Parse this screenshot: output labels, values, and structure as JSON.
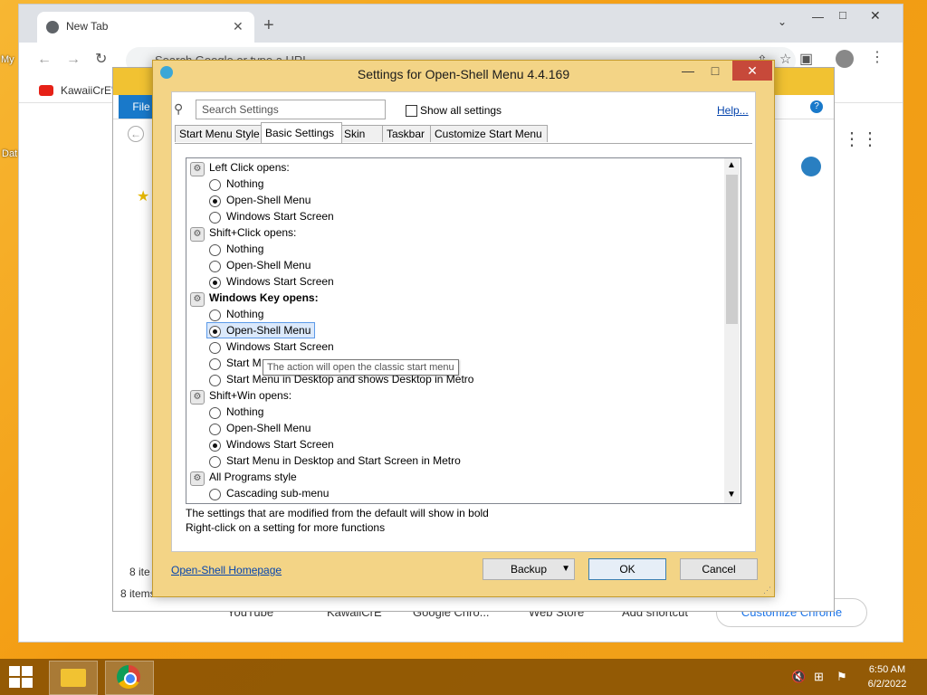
{
  "desktop": {
    "labels": [
      "My",
      "Dat"
    ]
  },
  "chrome": {
    "tab_title": "New Tab",
    "omnibox_placeholder": "Search Google or type a URL",
    "bookmark_1": "KawaiiCrE's",
    "shortcuts": [
      "YouTube",
      "KawaiiCrE",
      "Google Chro...",
      "Web Store",
      "Add shortcut"
    ],
    "customize_label": "Customize Chrome"
  },
  "explorer": {
    "file_tab": "File",
    "status_a": "8 ite",
    "status_b": "8 items"
  },
  "dialog": {
    "title": "Settings for Open-Shell Menu 4.4.169",
    "search_placeholder": "Search Settings",
    "show_all_label": "Show all settings",
    "help_link": "Help...",
    "tabs": [
      "Start Menu Style",
      "Basic Settings",
      "Skin",
      "Taskbar",
      "Customize Start Menu"
    ],
    "settings": {
      "left_click": {
        "heading": "Left Click opens:",
        "options": [
          "Nothing",
          "Open-Shell Menu",
          "Windows Start Screen"
        ]
      },
      "shift_click": {
        "heading": "Shift+Click opens:",
        "options": [
          "Nothing",
          "Open-Shell Menu",
          "Windows Start Screen"
        ]
      },
      "win_key": {
        "heading": "Windows Key opens:",
        "options": [
          "Nothing",
          "Open-Shell Menu",
          "Windows Start Screen",
          "Start M",
          "Start Menu in Desktop and shows Desktop in Metro"
        ]
      },
      "shift_win": {
        "heading": "Shift+Win opens:",
        "options": [
          "Nothing",
          "Open-Shell Menu",
          "Windows Start Screen",
          "Start Menu in Desktop and Start Screen in Metro"
        ]
      },
      "all_programs": {
        "heading": "All Programs style",
        "options": [
          "Cascading sub-menu"
        ]
      }
    },
    "tooltip": "The action will open the classic start menu",
    "note_1": "The settings that are modified from the default will show in bold",
    "note_2": "Right-click on a setting for more functions",
    "homepage_link": "Open-Shell Homepage",
    "backup_label": "Backup",
    "ok_label": "OK",
    "cancel_label": "Cancel"
  },
  "taskbar": {
    "time": "6:50 AM",
    "date": "6/2/2022"
  },
  "colors": {
    "dialog_frame": "#f3d486",
    "close_button": "#c7493a",
    "link": "#0645ad",
    "desktop": "#f39c12"
  }
}
